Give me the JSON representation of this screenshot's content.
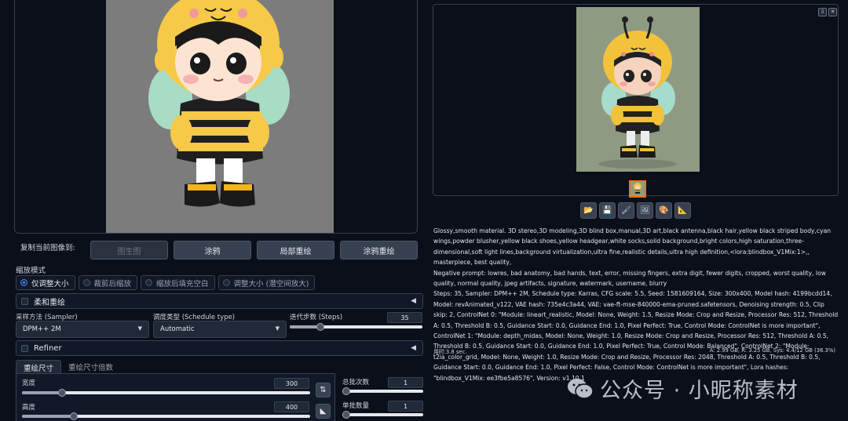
{
  "left": {
    "copy_label": "复制当前图像到:",
    "copy_buttons": [
      "图生图",
      "涂鸦",
      "局部重绘",
      "涂鸦重绘"
    ],
    "resize_mode_label": "缩放模式",
    "resize_modes": [
      "仅调整大小",
      "裁剪后缩放",
      "缩放后填充空白",
      "调整大小 (潜空间放大)"
    ],
    "soft_inpaint_label": "柔和重绘",
    "sampler_label": "采样方法 (Sampler)",
    "sampler_value": "DPM++ 2M",
    "schedule_label": "调度类型 (Schedule type)",
    "schedule_value": "Automatic",
    "steps_label": "迭代步数 (Steps)",
    "steps_value": "35",
    "steps_fraction": 0.23,
    "refiner_label": "Refiner",
    "tabs": [
      "重绘尺寸",
      "重绘尺寸倍数"
    ],
    "width_label": "宽度",
    "width_value": "300",
    "width_fraction": 0.14,
    "height_label": "高度",
    "height_value": "400",
    "height_fraction": 0.18,
    "batch_count_label": "总批次数",
    "batch_count_value": "1",
    "batch_size_label": "单批数量",
    "batch_size_value": "1",
    "swap_icon": "⇅",
    "ruler_icon": "◣"
  },
  "right": {
    "window_buttons": [
      "⇩",
      "✕"
    ],
    "tool_icons": [
      "📂",
      "💾",
      "🖌",
      "🖼",
      "🎨",
      "📐"
    ],
    "info_lines": [
      "Glossy,smooth material. 3D stereo,3D modeling,3D blind box,manual,3D art,black antenna,black hair,yellow black striped body,cyan wings,powder blusher,yellow black shoes,yellow headgear,white socks,solid background,bright colors,high saturation,three-dimensional,soft light lines,background virtualization,ultra fine,realistic details,ultra high definition,<lora:blindbox_V1Mix:1>,, masterpiece, best quality,",
      "Negative prompt: lowres, bad anatomy, bad hands, text, error, missing fingers, extra digit, fewer digits, cropped, worst quality, low quality, normal quality, jpeg artifacts, signature, watermark, username, blurry",
      "Steps: 35, Sampler: DPM++ 2M, Schedule type: Karras, CFG scale: 5.5, Seed: 1581609164, Size: 300x400, Model hash: 4199bcdd14, Model: revAnimated_v122, VAE hash: 735e4c3a44, VAE: vae-ft-mse-840000-ema-pruned.safetensors, Denoising strength: 0.5, Clip skip: 2, ControlNet 0: \"Module: lineart_realistic, Model: None, Weight: 1.5, Resize Mode: Crop and Resize, Processor Res: 512, Threshold A: 0.5, Threshold B: 0.5, Guidance Start: 0.0, Guidance End: 1.0, Pixel Perfect: True, Control Mode: ControlNet is more important\", ControlNet 1: \"Module: depth_midas, Model: None, Weight: 1.0, Resize Mode: Crop and Resize, Processor Res: 512, Threshold A: 0.5, Threshold B: 0.5, Guidance Start: 0.0, Guidance End: 1.0, Pixel Perfect: True, Control Mode: Balanced\", ControlNet 2: \"Module: t2ia_color_grid, Model: None, Weight: 1.0, Resize Mode: Crop and Resize, Processor Res: 2048, Threshold A: 0.5, Threshold B: 0.5, Guidance Start: 0.0, Guidance End: 1.0, Pixel Perfect: False, Control Mode: ControlNet is more important\", Lora hashes: \"blindbox_V1Mix: ee3fbe5a8576\", Version: v1.10.1"
    ],
    "time_taken": "用时:3.8 sec.",
    "vram": "A: 2.99 GB, R: 3.25 GB, Sys: 4.4/12 GB (36.3%)"
  },
  "watermark": {
    "text": "公众号 · 小昵称素材"
  }
}
